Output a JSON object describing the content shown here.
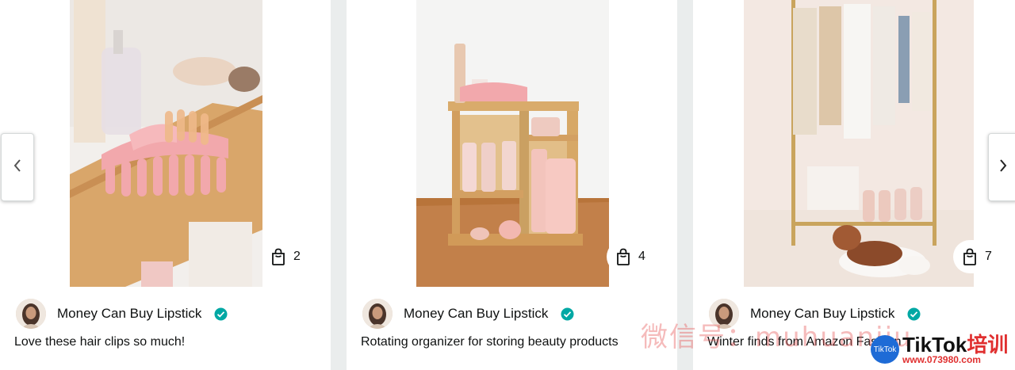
{
  "carousel": {
    "cards": [
      {
        "author": "Money Can Buy Lipstick",
        "caption": "Love these hair clips so much!",
        "product_count": "2",
        "image_icon": "hair-clip-photo"
      },
      {
        "author": "Money Can Buy Lipstick",
        "caption": "Rotating organizer for storing beauty products",
        "product_count": "4",
        "image_icon": "organizer-photo"
      },
      {
        "author": "Money Can Buy Lipstick",
        "caption": "Winter finds from Amazon Fashion",
        "product_count": "7",
        "image_icon": "clothing-rack-photo"
      }
    ],
    "prev_icon": "chevron-left-icon",
    "next_icon": "chevron-right-icon"
  },
  "watermark": {
    "text": "微信号：muhuanjiu",
    "logo_badge": "TikTok",
    "logo_word": "TikTok",
    "logo_cn": "培训",
    "logo_sub": "www.073980.com"
  },
  "colors": {
    "verified": "#00a8a4",
    "card_bg": "#ffffff",
    "page_bg": "#eaeded"
  }
}
